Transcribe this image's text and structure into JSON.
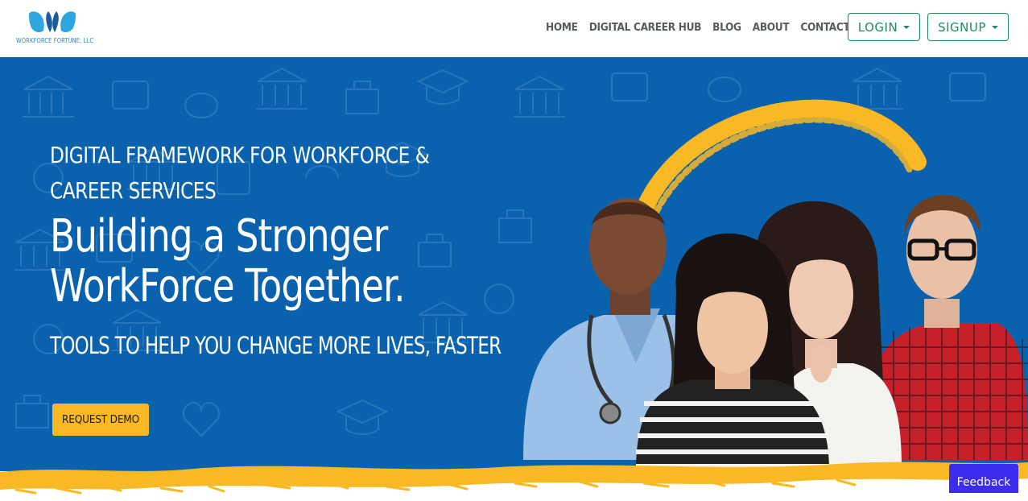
{
  "brand": {
    "logo_text": "WORKFORCE FORTUNE, LLC",
    "logo_icon": "butterfly-logo-icon"
  },
  "nav": {
    "links": [
      "HOME",
      "DIGITAL CAREER HUB",
      "BLOG",
      "ABOUT",
      "CONTACT US"
    ],
    "login_label": "LOGIN",
    "signup_label": "SIGNUP"
  },
  "hero": {
    "eyebrow": "DIGITAL FRAMEWORK FOR WORKFORCE & CAREER SERVICES",
    "heading": "Building a Stronger WorkForce Together.",
    "tagline": "TOOLS TO HELP YOU CHANGE MORE LIVES, FASTER",
    "cta_label": "REQUEST DEMO"
  },
  "feedback": {
    "label": "Feedback"
  },
  "colors": {
    "hero_blue": "#0a62ae",
    "accent_yellow": "#f9b925",
    "nav_green": "#1e8c5a",
    "feedback_purple": "#3d2cf0"
  }
}
